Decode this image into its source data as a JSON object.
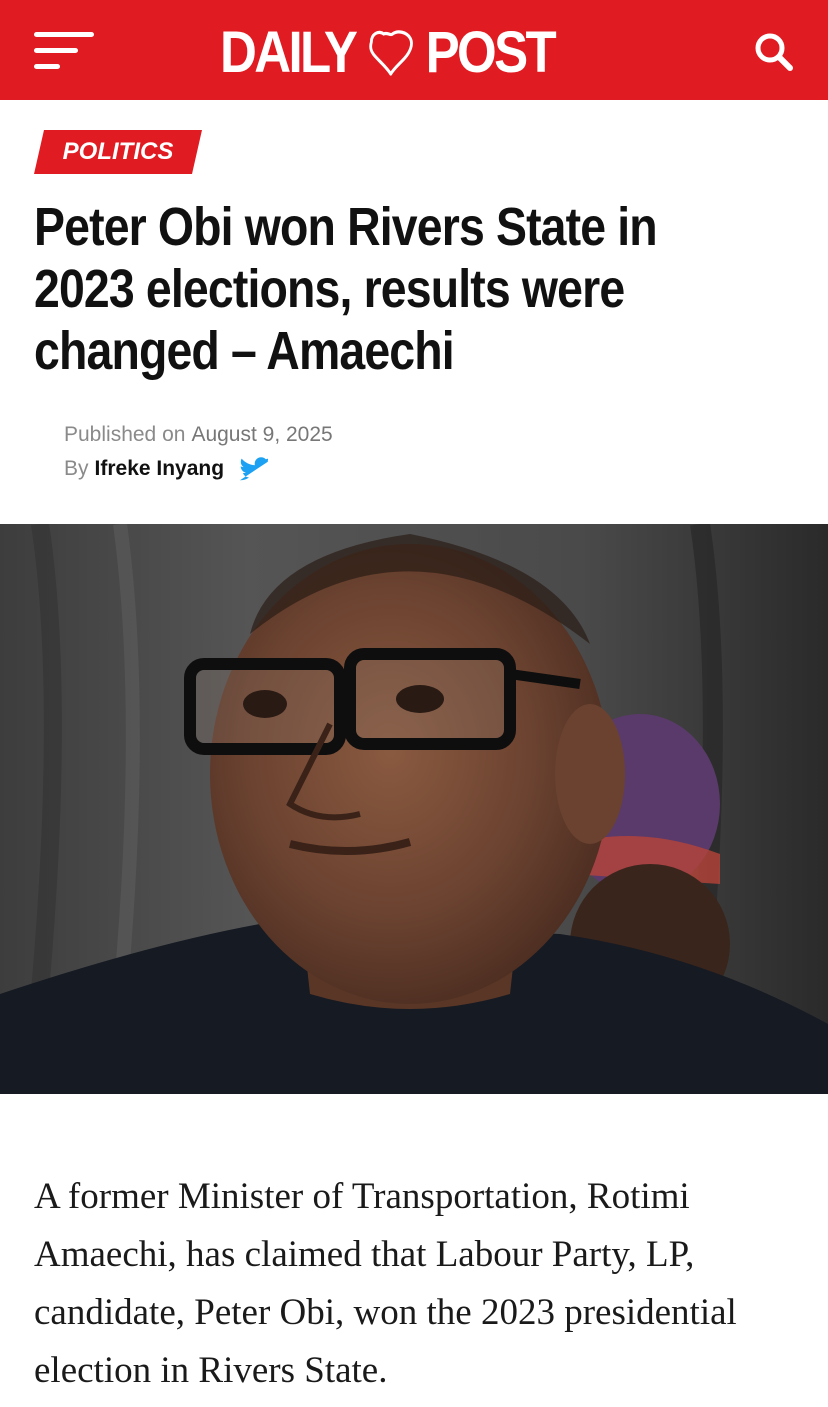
{
  "header": {
    "logo_left": "DAILY",
    "logo_right": "POST",
    "brand_color": "#e11b22",
    "menu_icon": "hamburger-menu-icon",
    "search_icon": "search-icon"
  },
  "article": {
    "category": "POLITICS",
    "headline": "Peter Obi won Rivers State in 2023 elections, results were changed – Amaechi",
    "published_label": "Published on",
    "published_date": "August 9, 2025",
    "by_label": "By",
    "author": "Ifreke Inyang",
    "author_social_icon": "twitter-bird-icon",
    "lead_paragraph": "A former Minister of Transportation, Rotimi Amaechi, has claimed that Labour Party, LP, candidate, Peter Obi, won the 2023 presidential election in Rivers State."
  }
}
